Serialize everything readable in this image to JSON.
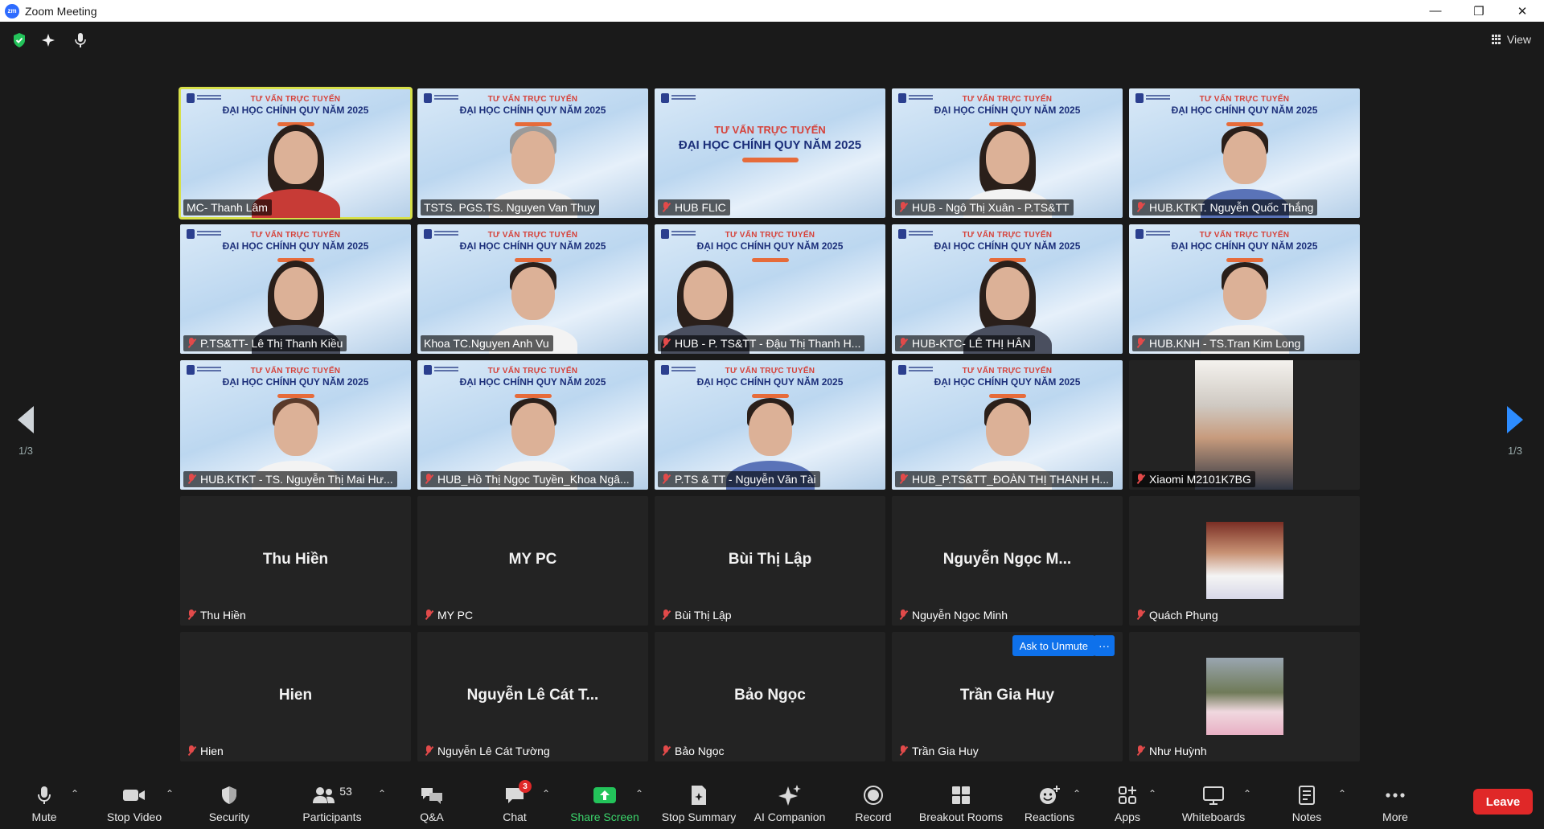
{
  "window": {
    "title": "Zoom Meeting",
    "logo_text": "zm",
    "minimize": "—",
    "restore": "❐",
    "close": "✕"
  },
  "topbar": {
    "view_label": "View"
  },
  "banner": {
    "line1": "TƯ VẤN TRỰC TUYẾN",
    "line2": "ĐẠI HỌC CHÍNH QUY NĂM 2025"
  },
  "pagination": {
    "left": "1/3",
    "right": "1/3"
  },
  "tiles": [
    {
      "name": "MC- Thanh Lâm",
      "muted": false,
      "kind": "video"
    },
    {
      "name": "TSTS. PGS.TS. Nguyen Van Thuy",
      "muted": false,
      "kind": "video"
    },
    {
      "name": "HUB FLIC",
      "muted": true,
      "kind": "video"
    },
    {
      "name": "HUB - Ngô Thị Xuân - P.TS&TT",
      "muted": true,
      "kind": "video"
    },
    {
      "name": "HUB.KTKT. Nguyễn Quốc Thắng",
      "muted": true,
      "kind": "video"
    },
    {
      "name": "P.TS&TT- Lê Thị Thanh Kiều",
      "muted": true,
      "kind": "video"
    },
    {
      "name": "Khoa TC.Nguyen Anh Vu",
      "muted": false,
      "kind": "video"
    },
    {
      "name": "HUB - P. TS&TT - Đậu Thị Thanh H...",
      "muted": true,
      "kind": "video"
    },
    {
      "name": "HUB-KTC- LÊ THỊ HÂN",
      "muted": true,
      "kind": "video"
    },
    {
      "name": "HUB.KNH - TS.Tran Kim Long",
      "muted": true,
      "kind": "video"
    },
    {
      "name": "HUB.KTKT - TS. Nguyễn Thị Mai Hư...",
      "muted": true,
      "kind": "video"
    },
    {
      "name": "HUB_Hồ Thị Ngọc Tuyền_Khoa Ngâ...",
      "muted": true,
      "kind": "video"
    },
    {
      "name": "P.TS & TT - Nguyễn Văn Tài",
      "muted": true,
      "kind": "video"
    },
    {
      "name": "HUB_P.TS&TT_ĐOÀN THỊ THANH H...",
      "muted": true,
      "kind": "video"
    },
    {
      "name": "Xiaomi M2101K7BG",
      "muted": true,
      "kind": "photo"
    },
    {
      "name": "Thu Hiền",
      "display": "Thu Hiền",
      "muted": true,
      "kind": "name"
    },
    {
      "name": "MY PC",
      "display": "MY PC",
      "muted": true,
      "kind": "name"
    },
    {
      "name": "Bùi Thị Lập",
      "display": "Bùi Thị Lập",
      "muted": true,
      "kind": "name"
    },
    {
      "name": "Nguyễn Ngọc Minh",
      "display": "Nguyễn Ngọc M...",
      "muted": true,
      "kind": "name"
    },
    {
      "name": "Quách Phụng",
      "muted": true,
      "kind": "avatar"
    },
    {
      "name": "Hien",
      "display": "Hien",
      "muted": true,
      "kind": "name"
    },
    {
      "name": "Nguyễn Lê Cát Tường",
      "display": "Nguyễn Lê Cát T...",
      "muted": true,
      "kind": "name"
    },
    {
      "name": "Bảo Ngọc",
      "display": "Bảo Ngọc",
      "muted": true,
      "kind": "name"
    },
    {
      "name": "Trần Gia Huy",
      "display": "Trần Gia Huy",
      "muted": true,
      "kind": "name"
    },
    {
      "name": "Như Huỳnh",
      "muted": true,
      "kind": "avatar"
    }
  ],
  "ask_to_unmute": {
    "label": "Ask to Unmute",
    "more": "···"
  },
  "toolbar": {
    "mute": "Mute",
    "stop_video": "Stop Video",
    "security": "Security",
    "participants": "Participants",
    "participants_count": "53",
    "qa": "Q&A",
    "chat": "Chat",
    "chat_badge": "3",
    "share_screen": "Share Screen",
    "stop_summary": "Stop Summary",
    "ai_companion": "AI Companion",
    "record": "Record",
    "breakout_rooms": "Breakout Rooms",
    "reactions": "Reactions",
    "apps": "Apps",
    "whiteboards": "Whiteboards",
    "notes": "Notes",
    "more": "More",
    "leave": "Leave"
  },
  "colors": {
    "accent": "#0e71eb",
    "leave": "#e02828",
    "share_green": "#3bd46b",
    "active_speaker": "#d7e04a",
    "muted_red": "#e24a4a"
  }
}
